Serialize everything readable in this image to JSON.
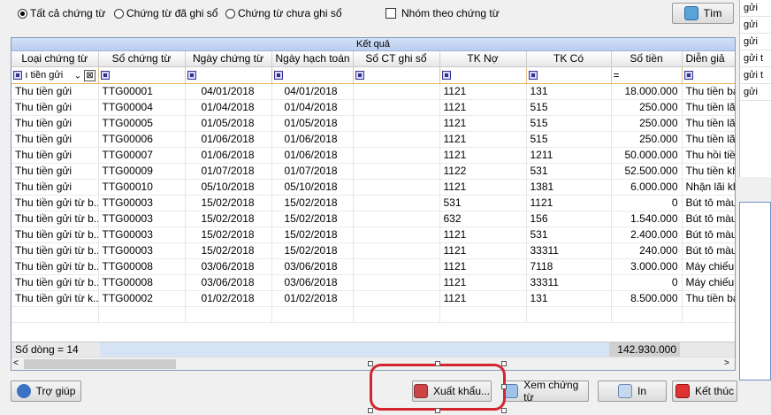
{
  "filter": {
    "radios": [
      {
        "label": "Tất cả chứng từ",
        "selected": true
      },
      {
        "label": "Chứng từ đã ghi sổ",
        "selected": false
      },
      {
        "label": "Chứng từ chưa ghi sổ",
        "selected": false
      }
    ],
    "group_label": "Nhóm theo chứng từ",
    "search_label": "Tìm"
  },
  "side_items": [
    "gửi",
    "gửi",
    "gửi",
    "gửi t",
    "gửi t",
    "gửi"
  ],
  "grid": {
    "caption": "Kết quả",
    "columns": [
      "Loại chứng từ",
      "Số chứng từ",
      "Ngày chứng từ",
      "Ngày hạch toán",
      "Số CT ghi sổ",
      "TK Nợ",
      "TK Có",
      "Số tiền",
      "Diễn giả"
    ],
    "filter_first_value": "ı tiền gửi",
    "filter_amount_op": "=",
    "rows": [
      [
        "Thu tiền gửi",
        "TTG00001",
        "04/01/2018",
        "04/01/2018",
        "",
        "1121",
        "131",
        "18.000.000",
        "Thu tiền bán"
      ],
      [
        "Thu tiền gửi",
        "TTG00004",
        "01/04/2018",
        "01/04/2018",
        "",
        "1121",
        "515",
        "250.000",
        "Thu tiền lãi"
      ],
      [
        "Thu tiền gửi",
        "TTG00005",
        "01/05/2018",
        "01/05/2018",
        "",
        "1121",
        "515",
        "250.000",
        "Thu tiền lãi"
      ],
      [
        "Thu tiền gửi",
        "TTG00006",
        "01/06/2018",
        "01/06/2018",
        "",
        "1121",
        "515",
        "250.000",
        "Thu tiền lãi"
      ],
      [
        "Thu tiền gửi",
        "TTG00007",
        "01/06/2018",
        "01/06/2018",
        "",
        "1121",
        "1211",
        "50.000.000",
        "Thu hồi tiền"
      ],
      [
        "Thu tiền gửi",
        "TTG00009",
        "01/07/2018",
        "01/07/2018",
        "",
        "1122",
        "531",
        "52.500.000",
        "Thu tiền khỏ"
      ],
      [
        "Thu tiền gửi",
        "TTG00010",
        "05/10/2018",
        "05/10/2018",
        "",
        "1121",
        "1381",
        "6.000.000",
        "Nhận lãi khỏ"
      ],
      [
        "Thu tiền gửi từ b...",
        "TTG00003",
        "15/02/2018",
        "15/02/2018",
        "",
        "531",
        "1121",
        "0",
        "Bút tô màu"
      ],
      [
        "Thu tiền gửi từ b...",
        "TTG00003",
        "15/02/2018",
        "15/02/2018",
        "",
        "632",
        "156",
        "1.540.000",
        "Bút tô màu"
      ],
      [
        "Thu tiền gửi từ b...",
        "TTG00003",
        "15/02/2018",
        "15/02/2018",
        "",
        "1121",
        "531",
        "2.400.000",
        "Bút tô màu"
      ],
      [
        "Thu tiền gửi từ b...",
        "TTG00003",
        "15/02/2018",
        "15/02/2018",
        "",
        "1121",
        "33311",
        "240.000",
        "Bút tô màu"
      ],
      [
        "Thu tiền gửi từ b...",
        "TTG00008",
        "03/06/2018",
        "03/06/2018",
        "",
        "1121",
        "7118",
        "3.000.000",
        "Máy chiếu S"
      ],
      [
        "Thu tiền gửi từ b...",
        "TTG00008",
        "03/06/2018",
        "03/06/2018",
        "",
        "1121",
        "33311",
        "0",
        "Máy chiếu S"
      ],
      [
        "Thu tiền gửi từ k...",
        "TTG00002",
        "01/02/2018",
        "01/02/2018",
        "",
        "1121",
        "131",
        "8.500.000",
        "Thu tiền bán"
      ]
    ],
    "footer_count": "Số dòng = 14",
    "footer_total": "142.930.000"
  },
  "buttons": {
    "help": "Trợ giúp",
    "export": "Xuất khẩu...",
    "view": "Xem chứng từ",
    "print": "In",
    "close": "Kết thúc"
  }
}
